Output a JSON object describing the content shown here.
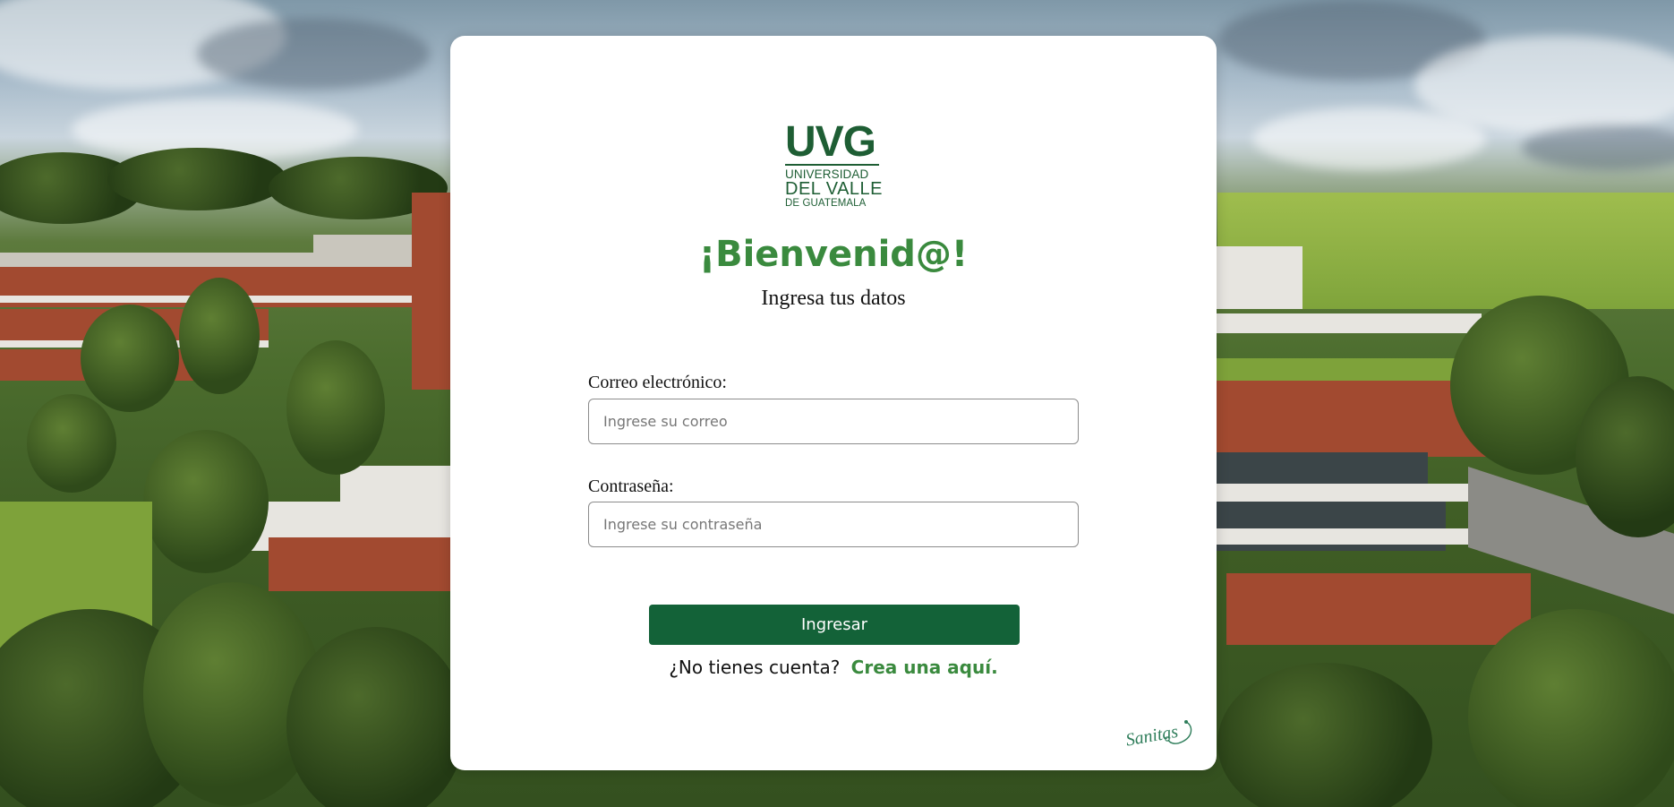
{
  "logo": {
    "mark": "UVG",
    "line1": "UNIVERSIDAD",
    "line2": "DEL VALLE",
    "line3": "DE GUATEMALA"
  },
  "login": {
    "title": "¡Bienvenid@!",
    "subtitle": "Ingresa tus datos",
    "email_label": "Correo electrónico:",
    "email_placeholder": "Ingrese su correo",
    "email_value": "",
    "password_label": "Contraseña:",
    "password_placeholder": "Ingrese su contraseña",
    "password_value": "",
    "submit_label": "Ingresar",
    "signup_prompt": "¿No tienes cuenta?",
    "signup_link": "Crea una aquí."
  },
  "brand": {
    "name": "Sanitas",
    "icon": "stethoscope-icon"
  },
  "colors": {
    "primary_green": "#136238",
    "accent_green": "#3a8a3e",
    "logo_green": "#1e5e34"
  }
}
